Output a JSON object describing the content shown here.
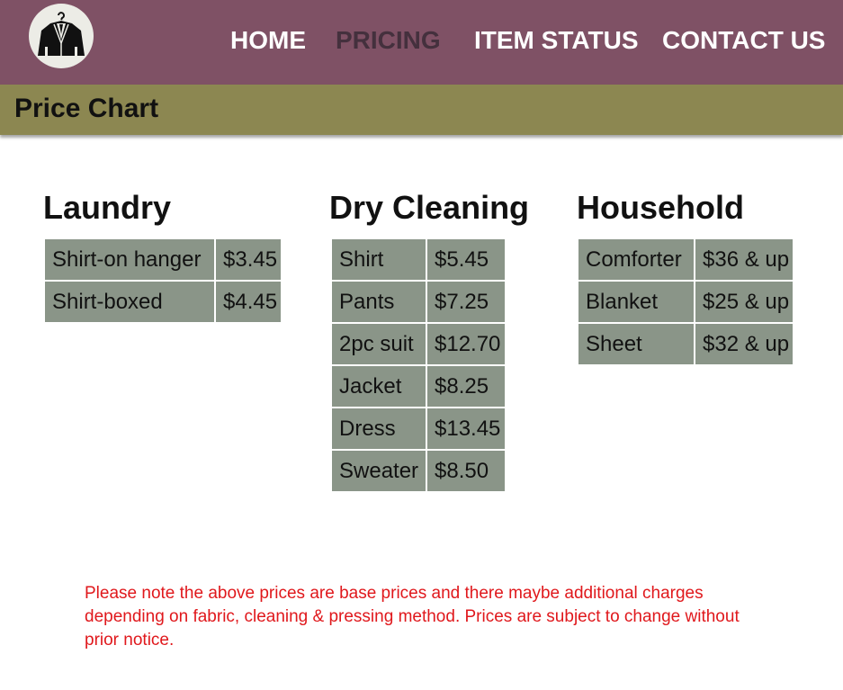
{
  "header": {
    "logo_icon": "suit-on-hanger-icon",
    "nav": [
      {
        "label": "HOME",
        "active": false
      },
      {
        "label": "PRICING",
        "active": true
      },
      {
        "label": "ITEM STATUS",
        "active": false
      },
      {
        "label": "CONTACT US",
        "active": false
      }
    ]
  },
  "subbar": {
    "title": "Price Chart"
  },
  "categories": {
    "laundry": {
      "title": "Laundry",
      "rows": [
        {
          "item": "Shirt-on hanger",
          "price": "$3.45"
        },
        {
          "item": "Shirt-boxed",
          "price": "$4.45"
        }
      ]
    },
    "dry_cleaning": {
      "title": "Dry Cleaning",
      "rows": [
        {
          "item": "Shirt",
          "price": "$5.45"
        },
        {
          "item": "Pants",
          "price": "$7.25"
        },
        {
          "item": "2pc suit",
          "price": "$12.70"
        },
        {
          "item": "Jacket",
          "price": "$8.25"
        },
        {
          "item": "Dress",
          "price": "$13.45"
        },
        {
          "item": "Sweater",
          "price": "$8.50"
        }
      ]
    },
    "household": {
      "title": "Household",
      "rows": [
        {
          "item": "Comforter",
          "price": "$36 & up"
        },
        {
          "item": "Blanket",
          "price": "$25 & up"
        },
        {
          "item": "Sheet",
          "price": "$32 & up"
        }
      ]
    }
  },
  "note": "Please note the above prices are base prices and there maybe additional charges depending on fabric, cleaning & pressing method. Prices are subject to change without prior notice.",
  "colors": {
    "header_bg": "#7f5165",
    "nav_active": "#44303d",
    "subbar_bg": "#8c8751",
    "cell_bg": "#8a9588",
    "note_text": "#e0181c"
  }
}
